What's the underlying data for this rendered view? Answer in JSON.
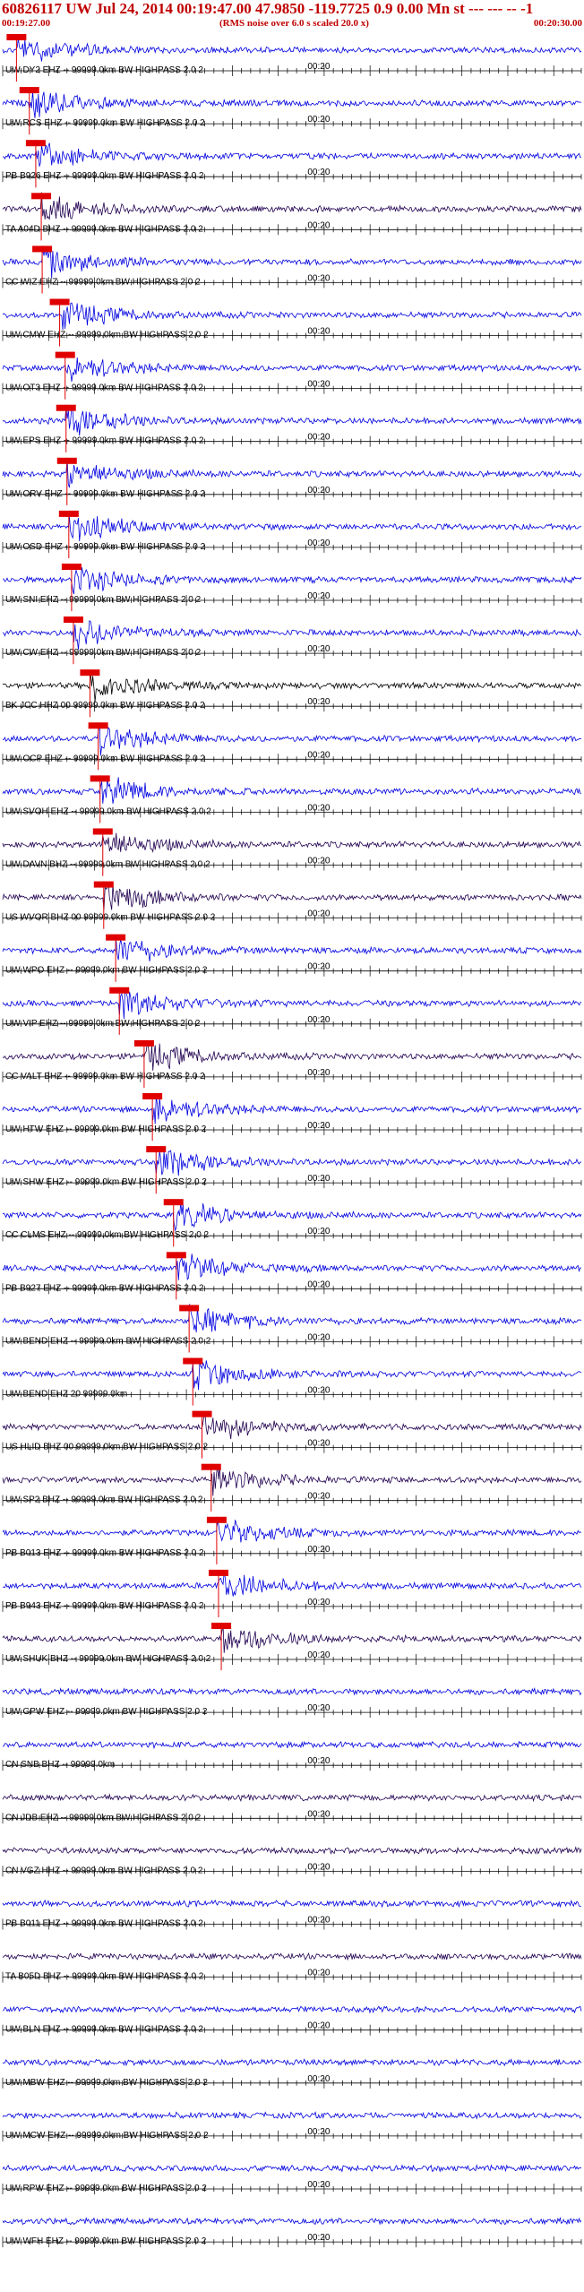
{
  "header": {
    "title": "60826117 UW Jul 24, 2014 00:19:47.00    47.9850 -119.7725   0.9 0.00 Mn st --- --- --   -1",
    "start_time": "00:19:27.00",
    "subtitle": "(RMS noise over 6.0 s scaled 20.0 x)",
    "end_time": "00:20:30.00"
  },
  "colors": {
    "blue_trace": "#0000e0",
    "dark_trace": "#200050",
    "black_trace": "#000000",
    "pick_box": "#e00000",
    "pick_line": "#e00000",
    "title": "#c00000"
  },
  "chart_data": {
    "type": "line",
    "title": "60826117 UW Jul 24, 2014 00:19:47.00    47.9850 -119.7725   0.9 0.00 Mn st --- --- --   -1",
    "time_window": [
      "00:19:27.00",
      "00:20:30.00"
    ],
    "mid_tick_label": "00:20",
    "grid": false,
    "series": [
      {
        "name": "UW DY2 EHZ -- 99999.0km BW  HIGHPASS  2.0  2",
        "color": "blue",
        "pick_time_s": 1.5
      },
      {
        "name": "UW RCS EHZ -- 99999.0km BW  HIGHPASS  2.0  2",
        "color": "blue",
        "pick_time_s": 2.9
      },
      {
        "name": "PB B926 EHZ -- 99999.0km BW  HIGHPASS  2.0  2",
        "color": "blue",
        "pick_time_s": 3.6
      },
      {
        "name": "TA A04D BHZ -- 99999.0km BW  HIGHPASS  2.0  2",
        "color": "dark",
        "pick_time_s": 4.2
      },
      {
        "name": "CC WIZ EHZ -- 99999.0km BW  HIGHPASS  2.0  2",
        "color": "blue",
        "pick_time_s": 4.3
      },
      {
        "name": "UW CMW EHZ -- 99999.0km BW  HIGHPASS  2.0  2",
        "color": "blue",
        "pick_time_s": 6.2
      },
      {
        "name": "UW OT3 EHZ -- 99999.0km BW  HIGHPASS  2.0  2",
        "color": "blue",
        "pick_time_s": 6.8
      },
      {
        "name": "UW EPS EHZ -- 99999.0km BW  HIGHPASS  2.0  2",
        "color": "blue",
        "pick_time_s": 6.9
      },
      {
        "name": "UW ORV EHZ -- 99999.0km BW  HIGHPASS  2.0  2",
        "color": "blue",
        "pick_time_s": 7.0
      },
      {
        "name": "UW OSD EHZ -- 99999.0km BW  HIGHPASS  2.0  2",
        "color": "blue",
        "pick_time_s": 7.2
      },
      {
        "name": "UW SNI EHZ -- 99999.0km BW  HIGHPASS  2.0  2",
        "color": "blue",
        "pick_time_s": 7.5
      },
      {
        "name": "UW CW EHZ -- 99999.0km BW  HIGHPASS  2.0  2",
        "color": "blue",
        "pick_time_s": 7.7
      },
      {
        "name": "BK JCC HHZ 00 99999.0km BW  HIGHPASS  2.0  2",
        "color": "black",
        "pick_time_s": 9.5
      },
      {
        "name": "UW OCP EHZ -- 99999.0km BW  HIGHPASS  2.0  2",
        "color": "blue",
        "pick_time_s": 10.4
      },
      {
        "name": "UW SVOH EHZ -- 99999.0km BW  HIGHPASS  2.0  2",
        "color": "blue",
        "pick_time_s": 10.6
      },
      {
        "name": "UW DAVN BHZ -- 99999.0km BW  HIGHPASS  2.0  2",
        "color": "dark",
        "pick_time_s": 10.9
      },
      {
        "name": "US WVOR BHZ 00 99999.0km BW  HIGHPASS  2.0  2",
        "color": "dark",
        "pick_time_s": 11.0
      },
      {
        "name": "UW WPO EHZ -- 99999.0km BW  HIGHPASS  2.0  2",
        "color": "blue",
        "pick_time_s": 12.3
      },
      {
        "name": "UW VIP EHZ -- 99999.0km BW  HIGHPASS  2.0  2",
        "color": "blue",
        "pick_time_s": 12.7
      },
      {
        "name": "CC VALT BHZ -- 99999.0km BW  HIGHPASS  2.0  2",
        "color": "dark",
        "pick_time_s": 15.4
      },
      {
        "name": "UW HTW EHZ -- 99999.0km BW  HIGHPASS  2.0  2",
        "color": "blue",
        "pick_time_s": 16.3
      },
      {
        "name": "UW SHW EHZ -- 99999.0km BW  HIGHPASS  2.0  2",
        "color": "blue",
        "pick_time_s": 16.7
      },
      {
        "name": "CC CLMS EHZ -- 99999.0km BW  HIGHPASS  2.0  2",
        "color": "blue",
        "pick_time_s": 18.6
      },
      {
        "name": "PB B927 EHZ -- 99999.0km BW  HIGHPASS  2.0  2",
        "color": "blue",
        "pick_time_s": 18.9
      },
      {
        "name": "UW BEND EHZ -- 99999.0km BW  HIGHPASS  2.0  2",
        "color": "blue",
        "pick_time_s": 20.3
      },
      {
        "name": "UW BEND EHZ 20 99999.0km",
        "color": "blue",
        "pick_time_s": 20.7
      },
      {
        "name": "US HLID BHZ 00 99999.0km BW  HIGHPASS  2.0  2",
        "color": "dark",
        "pick_time_s": 21.7
      },
      {
        "name": "UW SP2 BHZ -- 99999.0km BW  HIGHPASS  2.0  2",
        "color": "dark",
        "pick_time_s": 22.7
      },
      {
        "name": "PB B013 EHZ -- 99999.0km BW  HIGHPASS  2.0  2",
        "color": "blue",
        "pick_time_s": 23.3
      },
      {
        "name": "PB B943 EHZ -- 99999.0km BW  HIGHPASS  2.0  2",
        "color": "blue",
        "pick_time_s": 23.5
      },
      {
        "name": "UW SHUK BHZ -- 99999.0km BW  HIGHPASS  2.0  2",
        "color": "dark",
        "pick_time_s": 23.8
      },
      {
        "name": "UW GPW EHZ -- 99999.0km BW  HIGHPASS  2.0  2",
        "color": "blue",
        "pick_time_s": null
      },
      {
        "name": "CN SNB BHZ -- 99999.0km",
        "color": "blue",
        "pick_time_s": null
      },
      {
        "name": "CN JDB EHZ -- 99999.0km BW  HIGHPASS  2.0  2",
        "color": "dark",
        "pick_time_s": null
      },
      {
        "name": "CN VGZ HHZ -- 99999.0km BW  HIGHPASS  2.0  2",
        "color": "dark",
        "pick_time_s": null
      },
      {
        "name": "PB B011 EHZ -- 99999.0km BW  HIGHPASS  2.0  2",
        "color": "blue",
        "pick_time_s": null
      },
      {
        "name": "TA B05D BHZ -- 99999.0km BW  HIGHPASS  2.0  2",
        "color": "dark",
        "pick_time_s": null
      },
      {
        "name": "UW BLN EHZ -- 99999.0km BW  HIGHPASS  2.0  2",
        "color": "blue",
        "pick_time_s": null
      },
      {
        "name": "UW MBW EHZ -- 99999.0km BW  HIGHPASS  2.0  2",
        "color": "blue",
        "pick_time_s": null
      },
      {
        "name": "UW MCW EHZ -- 99999.0km BW  HIGHPASS  2.0  2",
        "color": "blue",
        "pick_time_s": null
      },
      {
        "name": "UW RPW EHZ -- 99999.0km BW  HIGHPASS  2.0  2",
        "color": "blue",
        "pick_time_s": null
      },
      {
        "name": "UW WFH EHZ -- 99999.0km BW  HIGHPASS  2.0  2",
        "color": "blue",
        "pick_time_s": null
      }
    ]
  }
}
